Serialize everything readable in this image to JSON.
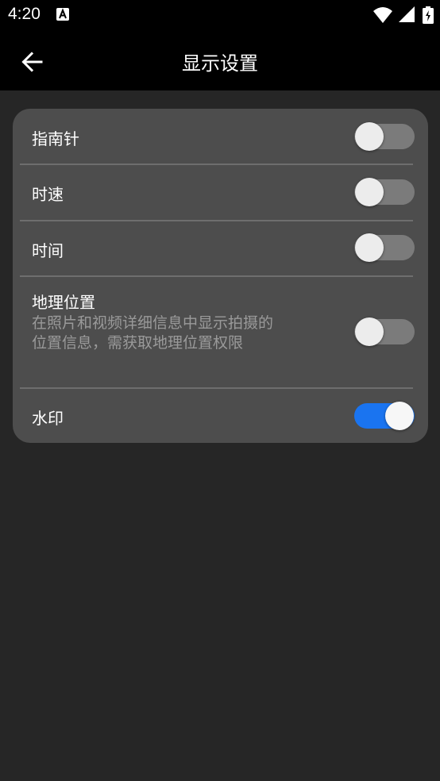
{
  "status_bar": {
    "time": "4:20",
    "notification_icon": "font-a-icon",
    "wifi_icon": "wifi-icon",
    "signal_icon": "cell-signal-icon",
    "battery_icon": "battery-charging-icon"
  },
  "app_bar": {
    "back_icon": "arrow-left-icon",
    "title": "显示设置"
  },
  "settings": {
    "items": [
      {
        "label": "指南针",
        "enabled": false
      },
      {
        "label": "时速",
        "enabled": false
      },
      {
        "label": "时间",
        "enabled": false
      },
      {
        "label": "地理位置",
        "description": "在照片和视频详细信息中显示拍摄的位置信息，需获取地理位置权限",
        "enabled": false
      },
      {
        "label": "水印",
        "enabled": true
      }
    ]
  },
  "colors": {
    "background": "#262626",
    "card": "#4d4d4d",
    "switch_on": "#1a74f0",
    "switch_off": "#7b7b7b",
    "description_text": "#9a9a9a"
  }
}
